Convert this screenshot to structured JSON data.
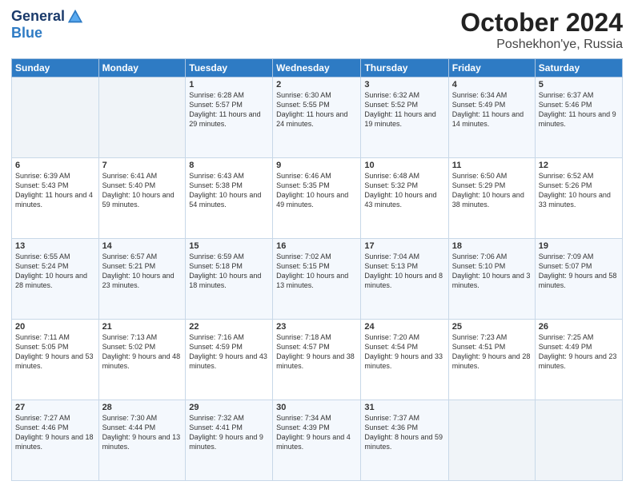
{
  "logo": {
    "general": "General",
    "blue": "Blue",
    "tagline": ""
  },
  "header": {
    "title": "October 2024",
    "subtitle": "Poshekhon'ye, Russia"
  },
  "weekdays": [
    "Sunday",
    "Monday",
    "Tuesday",
    "Wednesday",
    "Thursday",
    "Friday",
    "Saturday"
  ],
  "weeks": [
    [
      {
        "day": "",
        "sunrise": "",
        "sunset": "",
        "daylight": ""
      },
      {
        "day": "",
        "sunrise": "",
        "sunset": "",
        "daylight": ""
      },
      {
        "day": "1",
        "sunrise": "Sunrise: 6:28 AM",
        "sunset": "Sunset: 5:57 PM",
        "daylight": "Daylight: 11 hours and 29 minutes."
      },
      {
        "day": "2",
        "sunrise": "Sunrise: 6:30 AM",
        "sunset": "Sunset: 5:55 PM",
        "daylight": "Daylight: 11 hours and 24 minutes."
      },
      {
        "day": "3",
        "sunrise": "Sunrise: 6:32 AM",
        "sunset": "Sunset: 5:52 PM",
        "daylight": "Daylight: 11 hours and 19 minutes."
      },
      {
        "day": "4",
        "sunrise": "Sunrise: 6:34 AM",
        "sunset": "Sunset: 5:49 PM",
        "daylight": "Daylight: 11 hours and 14 minutes."
      },
      {
        "day": "5",
        "sunrise": "Sunrise: 6:37 AM",
        "sunset": "Sunset: 5:46 PM",
        "daylight": "Daylight: 11 hours and 9 minutes."
      }
    ],
    [
      {
        "day": "6",
        "sunrise": "Sunrise: 6:39 AM",
        "sunset": "Sunset: 5:43 PM",
        "daylight": "Daylight: 11 hours and 4 minutes."
      },
      {
        "day": "7",
        "sunrise": "Sunrise: 6:41 AM",
        "sunset": "Sunset: 5:40 PM",
        "daylight": "Daylight: 10 hours and 59 minutes."
      },
      {
        "day": "8",
        "sunrise": "Sunrise: 6:43 AM",
        "sunset": "Sunset: 5:38 PM",
        "daylight": "Daylight: 10 hours and 54 minutes."
      },
      {
        "day": "9",
        "sunrise": "Sunrise: 6:46 AM",
        "sunset": "Sunset: 5:35 PM",
        "daylight": "Daylight: 10 hours and 49 minutes."
      },
      {
        "day": "10",
        "sunrise": "Sunrise: 6:48 AM",
        "sunset": "Sunset: 5:32 PM",
        "daylight": "Daylight: 10 hours and 43 minutes."
      },
      {
        "day": "11",
        "sunrise": "Sunrise: 6:50 AM",
        "sunset": "Sunset: 5:29 PM",
        "daylight": "Daylight: 10 hours and 38 minutes."
      },
      {
        "day": "12",
        "sunrise": "Sunrise: 6:52 AM",
        "sunset": "Sunset: 5:26 PM",
        "daylight": "Daylight: 10 hours and 33 minutes."
      }
    ],
    [
      {
        "day": "13",
        "sunrise": "Sunrise: 6:55 AM",
        "sunset": "Sunset: 5:24 PM",
        "daylight": "Daylight: 10 hours and 28 minutes."
      },
      {
        "day": "14",
        "sunrise": "Sunrise: 6:57 AM",
        "sunset": "Sunset: 5:21 PM",
        "daylight": "Daylight: 10 hours and 23 minutes."
      },
      {
        "day": "15",
        "sunrise": "Sunrise: 6:59 AM",
        "sunset": "Sunset: 5:18 PM",
        "daylight": "Daylight: 10 hours and 18 minutes."
      },
      {
        "day": "16",
        "sunrise": "Sunrise: 7:02 AM",
        "sunset": "Sunset: 5:15 PM",
        "daylight": "Daylight: 10 hours and 13 minutes."
      },
      {
        "day": "17",
        "sunrise": "Sunrise: 7:04 AM",
        "sunset": "Sunset: 5:13 PM",
        "daylight": "Daylight: 10 hours and 8 minutes."
      },
      {
        "day": "18",
        "sunrise": "Sunrise: 7:06 AM",
        "sunset": "Sunset: 5:10 PM",
        "daylight": "Daylight: 10 hours and 3 minutes."
      },
      {
        "day": "19",
        "sunrise": "Sunrise: 7:09 AM",
        "sunset": "Sunset: 5:07 PM",
        "daylight": "Daylight: 9 hours and 58 minutes."
      }
    ],
    [
      {
        "day": "20",
        "sunrise": "Sunrise: 7:11 AM",
        "sunset": "Sunset: 5:05 PM",
        "daylight": "Daylight: 9 hours and 53 minutes."
      },
      {
        "day": "21",
        "sunrise": "Sunrise: 7:13 AM",
        "sunset": "Sunset: 5:02 PM",
        "daylight": "Daylight: 9 hours and 48 minutes."
      },
      {
        "day": "22",
        "sunrise": "Sunrise: 7:16 AM",
        "sunset": "Sunset: 4:59 PM",
        "daylight": "Daylight: 9 hours and 43 minutes."
      },
      {
        "day": "23",
        "sunrise": "Sunrise: 7:18 AM",
        "sunset": "Sunset: 4:57 PM",
        "daylight": "Daylight: 9 hours and 38 minutes."
      },
      {
        "day": "24",
        "sunrise": "Sunrise: 7:20 AM",
        "sunset": "Sunset: 4:54 PM",
        "daylight": "Daylight: 9 hours and 33 minutes."
      },
      {
        "day": "25",
        "sunrise": "Sunrise: 7:23 AM",
        "sunset": "Sunset: 4:51 PM",
        "daylight": "Daylight: 9 hours and 28 minutes."
      },
      {
        "day": "26",
        "sunrise": "Sunrise: 7:25 AM",
        "sunset": "Sunset: 4:49 PM",
        "daylight": "Daylight: 9 hours and 23 minutes."
      }
    ],
    [
      {
        "day": "27",
        "sunrise": "Sunrise: 7:27 AM",
        "sunset": "Sunset: 4:46 PM",
        "daylight": "Daylight: 9 hours and 18 minutes."
      },
      {
        "day": "28",
        "sunrise": "Sunrise: 7:30 AM",
        "sunset": "Sunset: 4:44 PM",
        "daylight": "Daylight: 9 hours and 13 minutes."
      },
      {
        "day": "29",
        "sunrise": "Sunrise: 7:32 AM",
        "sunset": "Sunset: 4:41 PM",
        "daylight": "Daylight: 9 hours and 9 minutes."
      },
      {
        "day": "30",
        "sunrise": "Sunrise: 7:34 AM",
        "sunset": "Sunset: 4:39 PM",
        "daylight": "Daylight: 9 hours and 4 minutes."
      },
      {
        "day": "31",
        "sunrise": "Sunrise: 7:37 AM",
        "sunset": "Sunset: 4:36 PM",
        "daylight": "Daylight: 8 hours and 59 minutes."
      },
      {
        "day": "",
        "sunrise": "",
        "sunset": "",
        "daylight": ""
      },
      {
        "day": "",
        "sunrise": "",
        "sunset": "",
        "daylight": ""
      }
    ]
  ]
}
